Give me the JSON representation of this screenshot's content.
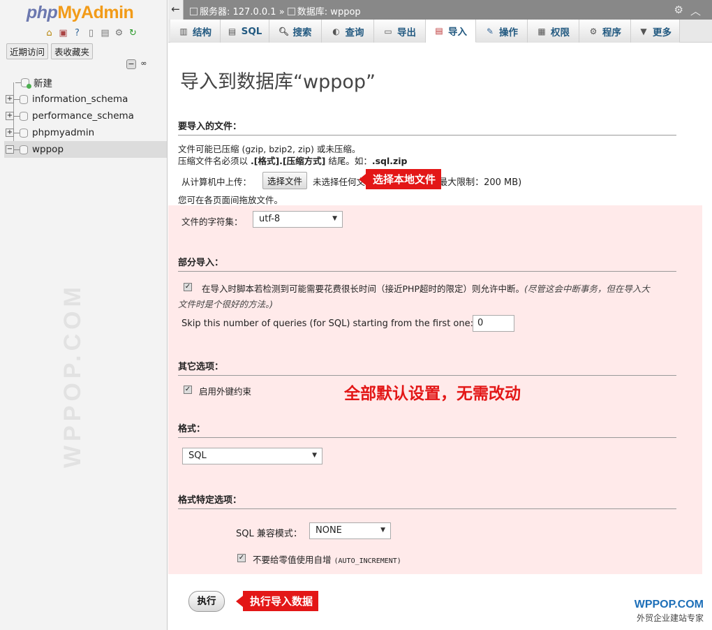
{
  "nav": {
    "logo_php": "php",
    "logo_myadmin": "MyAdmin",
    "recent_label": "近期访问",
    "favorites_label": "表收藏夹",
    "tree": [
      {
        "label": "新建"
      },
      {
        "label": "information_schema"
      },
      {
        "label": "performance_schema"
      },
      {
        "label": "phpmyadmin"
      },
      {
        "label": "wppop"
      }
    ],
    "watermark": "WPPOP.COM"
  },
  "topbar": {
    "server_label": "服务器: 127.0.0.1",
    "separator": "»",
    "database_label": "数据库: wppop"
  },
  "tabs": [
    {
      "label": "结构",
      "icon": "structure-icon"
    },
    {
      "label": "SQL",
      "icon": "sql-icon"
    },
    {
      "label": "搜索",
      "icon": "search-icon"
    },
    {
      "label": "查询",
      "icon": "query-icon"
    },
    {
      "label": "导出",
      "icon": "export-icon"
    },
    {
      "label": "导入",
      "icon": "import-icon"
    },
    {
      "label": "操作",
      "icon": "wrench-icon"
    },
    {
      "label": "权限",
      "icon": "privileges-icon"
    },
    {
      "label": "程序",
      "icon": "routines-icon"
    },
    {
      "label": "更多",
      "icon": "more-icon"
    }
  ],
  "main": {
    "title": "导入到数据库“wppop”",
    "file_section": {
      "heading": "要导入的文件：",
      "line1": "文件可能已压缩 (gzip, bzip2, zip) 或未压缩。",
      "line2_pre": "压缩文件名必须以 ",
      "line2_bold": ".[格式].[压缩方式]",
      "line2_mid": " 结尾。如：",
      "line2_example": ".sql.zip",
      "upload_label": "从计算机中上传：",
      "choose_button": "选择文件",
      "no_file_text": "未选择任何文件",
      "max_text": "(最大限制：200 MB)",
      "drag_text": "您可在各页面间拖放文件。",
      "charset_label": "文件的字符集：",
      "charset_value": "utf-8"
    },
    "partial_section": {
      "heading": "部分导入：",
      "allow_interrupt_text": "在导入时脚本若检测到可能需要花费很长时间（接近PHP超时的限定）则允许中断。",
      "allow_interrupt_note_1": "(尽管这会中断事务，但在导入大",
      "allow_interrupt_note_2": "文件时是个很好的方法。)",
      "skip_label": "Skip this number of queries (for SQL) starting from the first one:",
      "skip_value": "0"
    },
    "other_section": {
      "heading": "其它选项：",
      "fk_label": "启用外键约束"
    },
    "format_section": {
      "heading": "格式：",
      "format_value": "SQL"
    },
    "format_options_section": {
      "heading": "格式特定选项：",
      "compat_label": "SQL 兼容模式：",
      "compat_value": "NONE",
      "auto_inc_label": "不要给零值使用自增",
      "auto_inc_code": "(AUTO_INCREMENT)"
    },
    "go_button": "执行"
  },
  "annotations": {
    "choose_local": "选择本地文件",
    "defaults": "全部默认设置，无需改动",
    "run_import": "执行导入数据"
  },
  "brand": {
    "name": "WPPOP.COM",
    "tagline": "外贸企业建站专家"
  },
  "colors": {
    "accent_red": "#e31717",
    "tab_text": "#235a81",
    "pink_bg": "#ffeaea",
    "brand_blue": "#1d6fb8"
  }
}
